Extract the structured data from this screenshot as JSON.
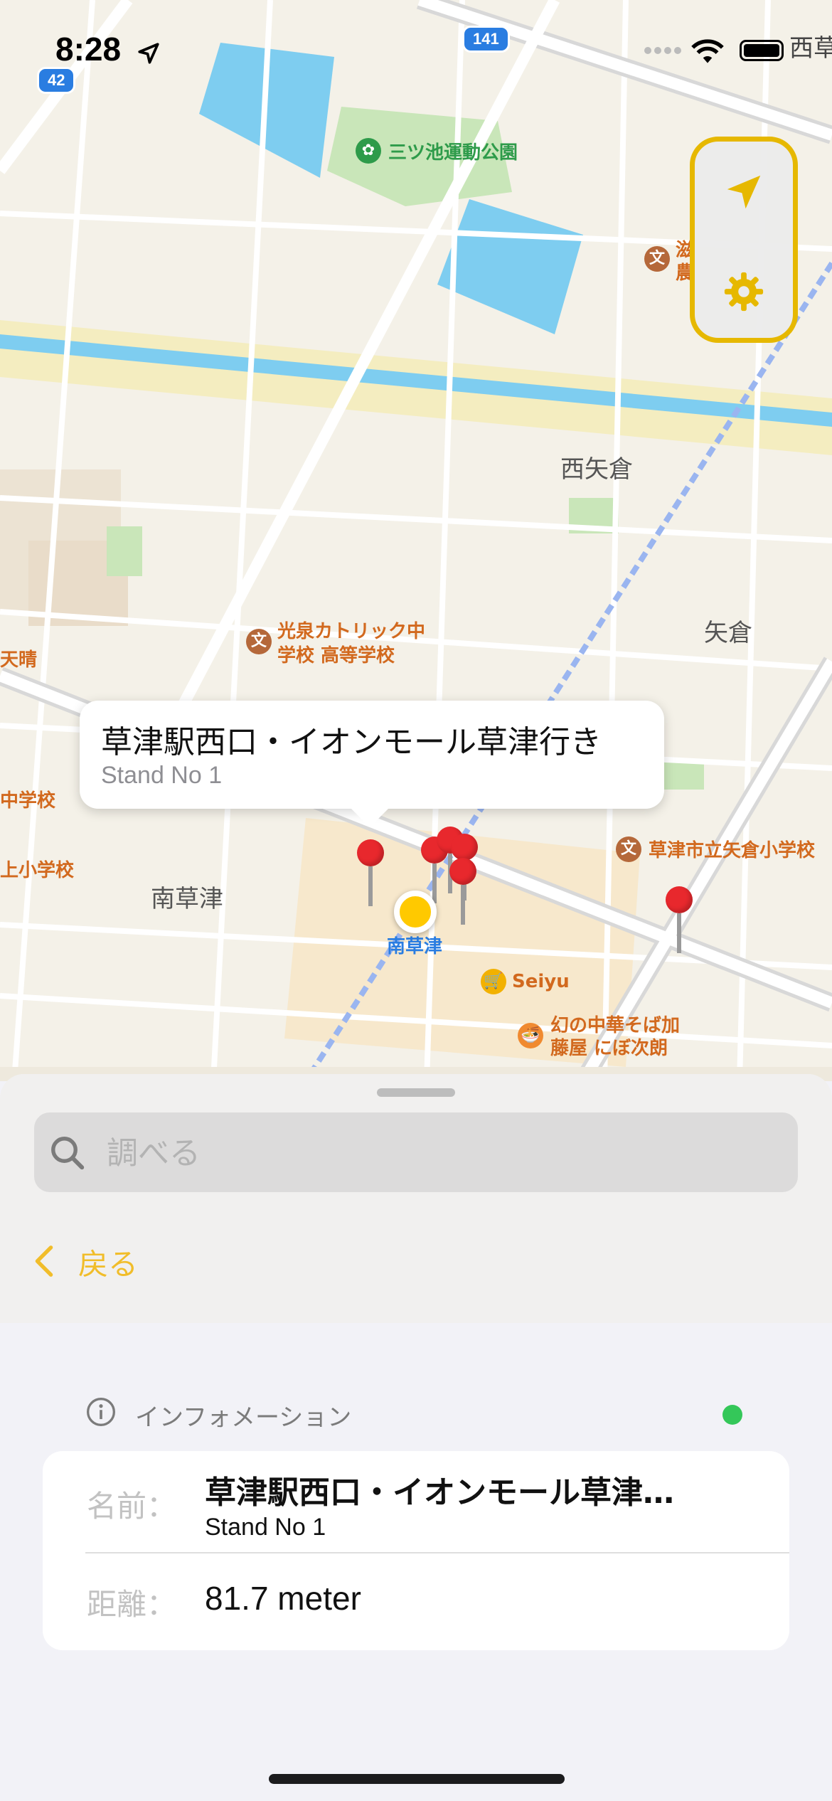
{
  "status_bar": {
    "time": "8:28"
  },
  "map": {
    "route_badges": [
      "42",
      "141"
    ],
    "labels": {
      "park": "三ツ池運動公園",
      "district_nishiyagura": "西矢倉",
      "district_yagura": "矢倉",
      "district_minamikusatsu": "南草津",
      "school_koizumi_line1": "光泉カトリック中",
      "school_koizumi_line2": "学校 高等学校",
      "school_yagura": "草津市立矢倉小学校",
      "station": "南草津",
      "seiyu": "Seiyu",
      "restaurant_line1": "幻の中華そば加",
      "restaurant_line2": "藤屋 にぼ次朗",
      "edge_tenbare": "天晴",
      "edge_chugakko": "中学校",
      "edge_shogakko": "上小学校",
      "edge_nishi": "西草",
      "edge_poi_right": "滋",
      "edge_poi_right2": "農"
    },
    "callout": {
      "title": "草津駅西口・イオンモール草津行き",
      "subtitle": "Stand No 1"
    }
  },
  "controls": {
    "location_icon": "location-arrow-icon",
    "settings_icon": "gear-icon",
    "accent_color": "#e6b800"
  },
  "search": {
    "placeholder": "調べる",
    "value": ""
  },
  "back": {
    "label": "戻る"
  },
  "info": {
    "header": "インフォメーション",
    "status_color": "#34c759",
    "name_label": "名前：",
    "name_value": "草津駅西口・イオンモール草津…",
    "name_sub": "Stand No 1",
    "distance_label": "距離：",
    "distance_value": "81.7 meter"
  }
}
